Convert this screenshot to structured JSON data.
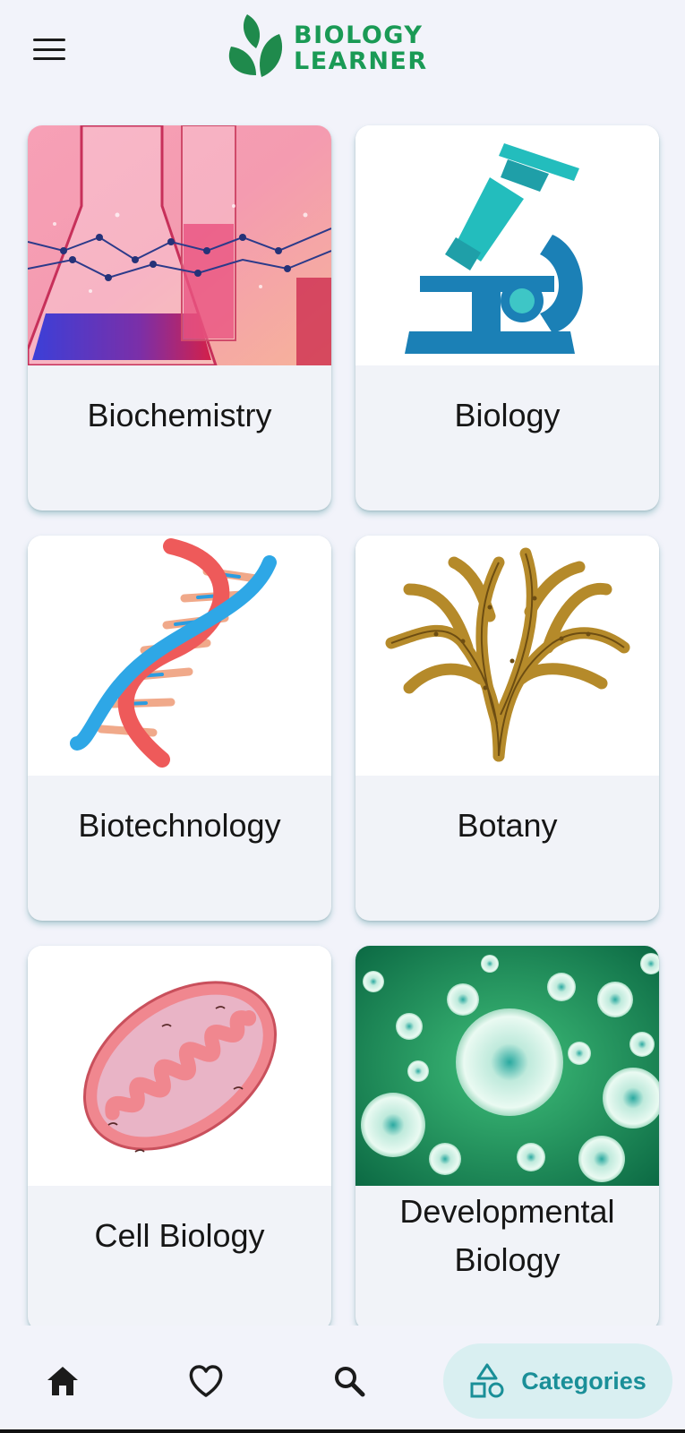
{
  "header": {
    "menu_icon": "hamburger-menu-icon",
    "logo_line1": "BIOLOGY",
    "logo_line2": "LEARNER",
    "brand_color": "#1a9a55"
  },
  "categories": [
    {
      "label": "Biochemistry",
      "image": "lab-glassware-photo"
    },
    {
      "label": "Biology",
      "image": "microscope-illustration"
    },
    {
      "label": "Biotechnology",
      "image": "dna-helix-illustration"
    },
    {
      "label": "Botany",
      "image": "seaweed-plant-illustration"
    },
    {
      "label": "Cell Biology",
      "image": "mitochondrion-illustration"
    },
    {
      "label": "Developmental Biology",
      "image": "green-cells-photo"
    }
  ],
  "nav": {
    "home_icon": "home-icon",
    "favorites_icon": "heart-icon",
    "search_icon": "search-icon",
    "categories_icon": "shapes-icon",
    "categories_label": "Categories",
    "accent_color": "#1a8f98",
    "pill_color": "#d9eff1"
  }
}
